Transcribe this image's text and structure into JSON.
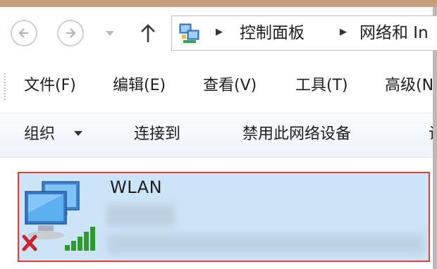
{
  "nav": {
    "back_icon": "arrow-left-icon",
    "forward_icon": "arrow-right-icon",
    "recent_icon": "chevron-down-icon",
    "up_icon": "arrow-up-icon"
  },
  "address": {
    "icon": "network-connections-icon",
    "crumbs": [
      "控制面板",
      "网络和 In"
    ]
  },
  "menu": {
    "items": [
      "文件(F)",
      "编辑(E)",
      "查看(V)",
      "工具(T)",
      "高级(N"
    ]
  },
  "command_bar": {
    "organize": "组织",
    "connect_to": "连接到",
    "disable_device": "禁用此网络设备",
    "overflow": "诊"
  },
  "adapter": {
    "name": "WLAN",
    "status_icon": "disconnected-x-icon",
    "signal_icon": "wifi-signal-icon",
    "colors": {
      "tile_bg": "#cce4f7",
      "tile_border": "#e23b3b",
      "signal": "#2f9b2f",
      "x_mark": "#d0202a"
    }
  }
}
